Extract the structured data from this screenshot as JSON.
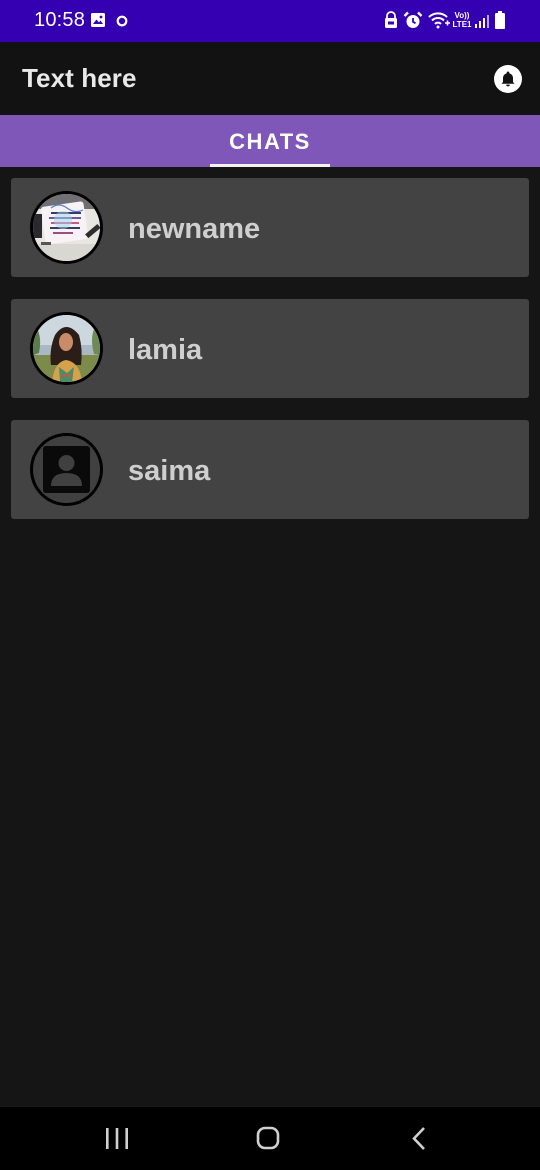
{
  "status_bar": {
    "time": "10:58",
    "background": "#3400b2",
    "icons": [
      "gallery-icon",
      "circle-notification-icon",
      "lock-icon",
      "alarm-icon",
      "wifi-calling-icon",
      "volte-icon",
      "signal-icon",
      "battery-icon"
    ],
    "volte_label": "Vo))",
    "lte_label": "LTE1"
  },
  "app_bar": {
    "title": "Text here",
    "notification_icon": "bell-icon"
  },
  "tabs": [
    {
      "label": "CHATS",
      "selected": true
    }
  ],
  "colors": {
    "accent": "#7e57b8",
    "background": "#151515",
    "card": "#434343",
    "name_text": "#cfcfcf"
  },
  "chats": [
    {
      "name": "newname",
      "avatar": "note-photo"
    },
    {
      "name": "lamia",
      "avatar": "person-photo"
    },
    {
      "name": "saima",
      "avatar": "default-contact-icon"
    }
  ],
  "nav_bar": {
    "buttons": [
      "recents-icon",
      "home-icon",
      "back-icon"
    ]
  }
}
